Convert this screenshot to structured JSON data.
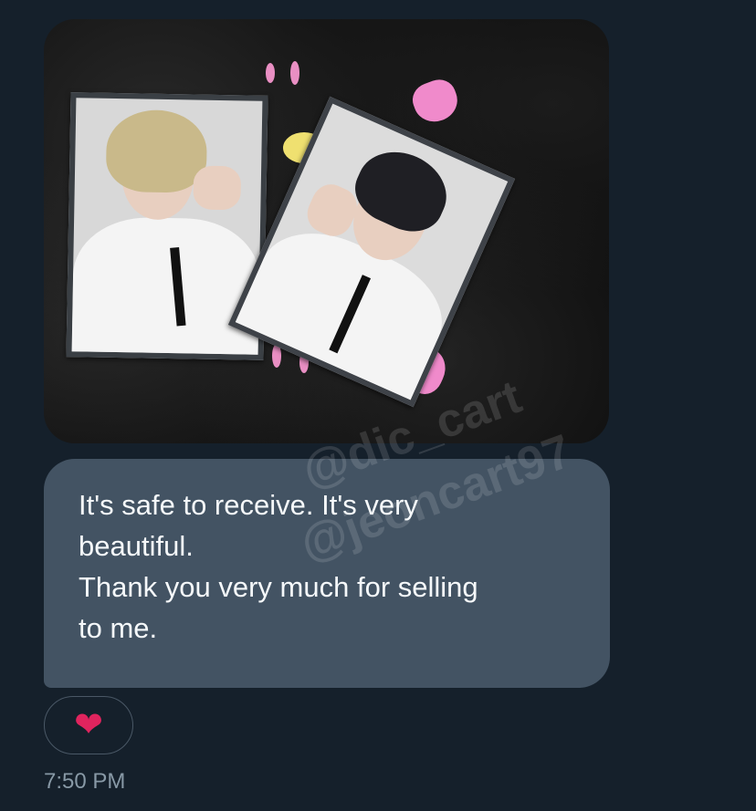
{
  "message": {
    "text": "It's safe to receive. It's very\nbeautiful.\nThank you very much for selling\nto me.",
    "reaction_emoji": "❤",
    "timestamp": "7:50 PM"
  },
  "watermarks": [
    "@dic_cart",
    "@jeoncart97"
  ],
  "colors": {
    "background": "#15202b",
    "bubble": "#435363",
    "text": "#f5f8fa",
    "timestamp": "#8899a6",
    "reaction_border": "#4a5866",
    "heart": "#e0245e"
  },
  "icons": {
    "reaction": "heart-icon"
  }
}
